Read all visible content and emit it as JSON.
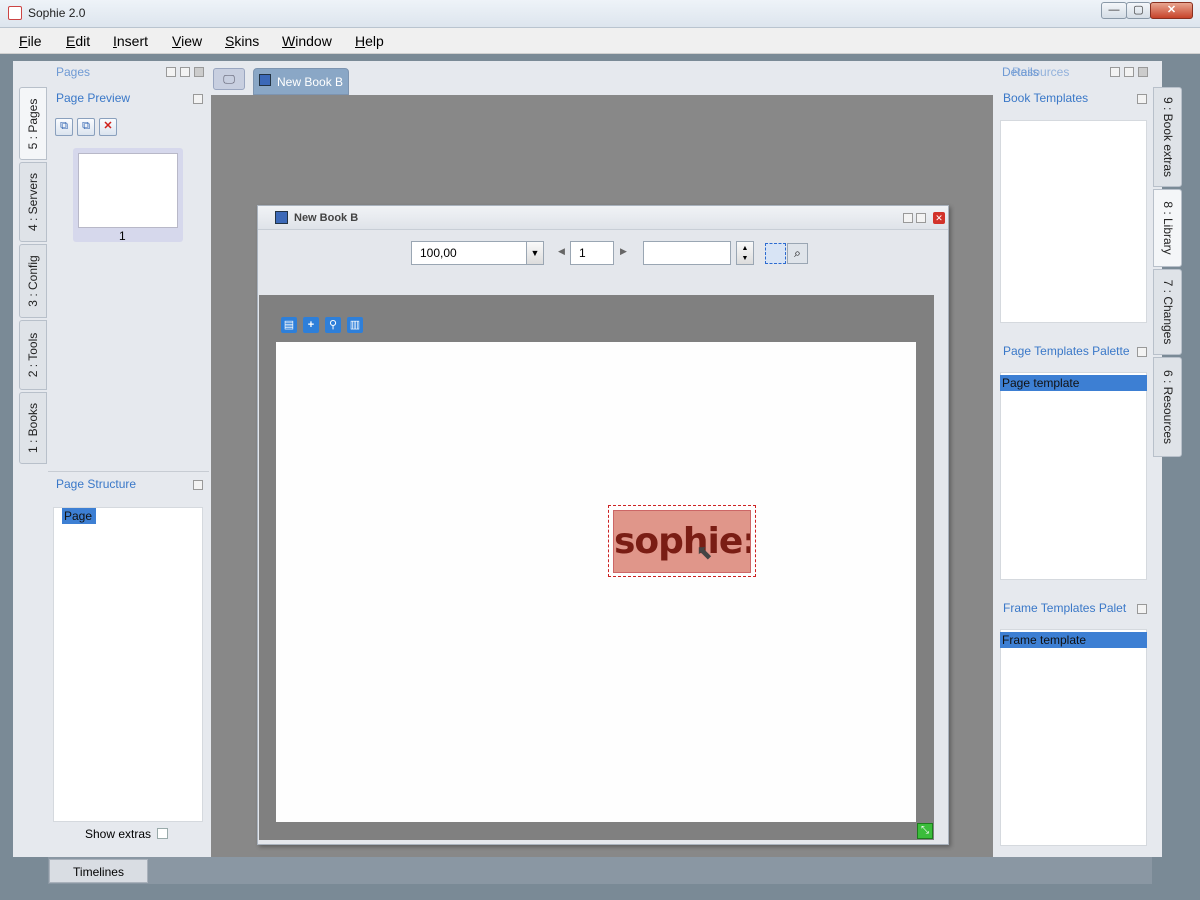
{
  "window": {
    "title": "Sophie 2.0",
    "minimize": "—",
    "maximize": "▢",
    "close": "✕"
  },
  "menu": [
    "File",
    "Edit",
    "Insert",
    "View",
    "Skins",
    "Window",
    "Help"
  ],
  "left_tabs": [
    "5 : Pages",
    "4 : Servers",
    "3 : Config",
    "2 : Tools",
    "1 : Books"
  ],
  "right_tabs": [
    "9 : Book extras",
    "8 : Library",
    "7 : Changes",
    "6 : Resources"
  ],
  "left_panel": {
    "header": "Pages",
    "page_preview": {
      "title": "Page Preview",
      "thumb_number": "1"
    },
    "page_structure": {
      "title": "Page Structure",
      "item": "Page"
    },
    "show_extras": "Show extras"
  },
  "bottom_tab": "Timelines",
  "doc_tab": "New Book B",
  "book_window": {
    "title": "New Book B",
    "zoom": "100,00",
    "page_number": "1",
    "logo_text": "sophie:"
  },
  "right_panel": {
    "header": "Resources",
    "header_overlap": "Details",
    "book_templates": "Book Templates",
    "page_templates": {
      "title": "Page Templates Palette",
      "item": "Page template"
    },
    "frame_templates": {
      "title": "Frame Templates Palet",
      "item": "Frame template"
    }
  },
  "colors": {
    "accent": "#3d7fd3",
    "panel_title": "#3a78c8",
    "frame_fill": "#e0968a",
    "logo_text": "#7a1d14"
  }
}
